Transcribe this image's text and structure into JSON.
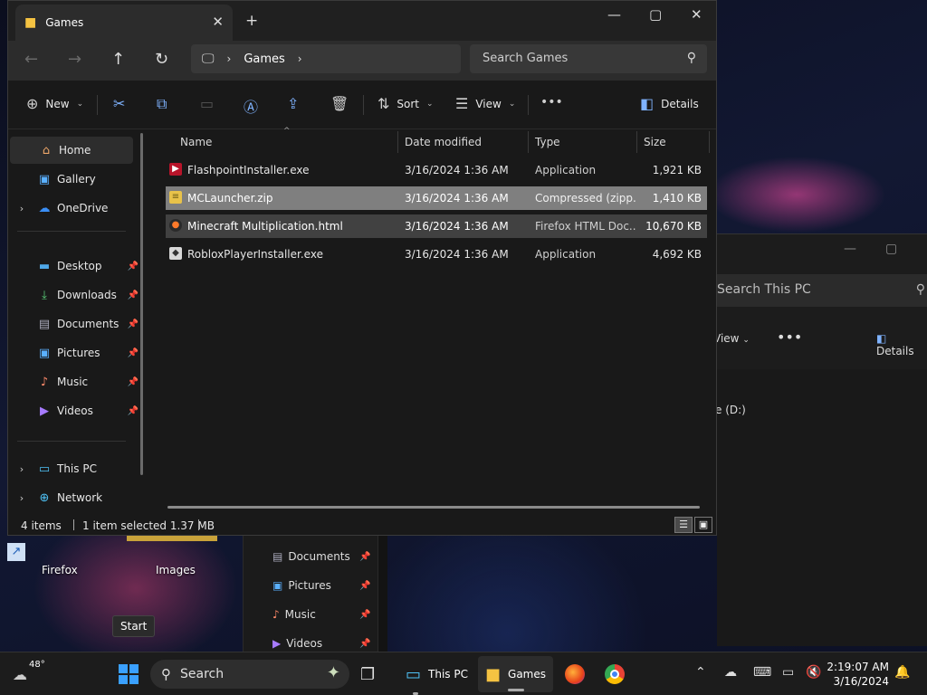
{
  "window": {
    "tab_title": "Games",
    "address_segment": "Games",
    "search_placeholder": "Search Games"
  },
  "toolbar": {
    "new_label": "New",
    "sort_label": "Sort",
    "view_label": "View",
    "details_label": "Details"
  },
  "sidebar": {
    "home": "Home",
    "gallery": "Gallery",
    "onedrive": "OneDrive",
    "desktop": "Desktop",
    "downloads": "Downloads",
    "documents": "Documents",
    "pictures": "Pictures",
    "music": "Music",
    "videos": "Videos",
    "thispc": "This PC",
    "network": "Network"
  },
  "columns": {
    "name": "Name",
    "date": "Date modified",
    "type": "Type",
    "size": "Size"
  },
  "files": [
    {
      "name": "FlashpointInstaller.exe",
      "date": "3/16/2024 1:36 AM",
      "type": "Application",
      "size": "1,921 KB"
    },
    {
      "name": "MCLauncher.zip",
      "date": "3/16/2024 1:36 AM",
      "type": "Compressed (zipp...",
      "size": "1,410 KB"
    },
    {
      "name": "Minecraft Multiplication.html",
      "date": "3/16/2024 1:36 AM",
      "type": "Firefox HTML Doc...",
      "size": "10,670 KB"
    },
    {
      "name": "RobloxPlayerInstaller.exe",
      "date": "3/16/2024 1:36 AM",
      "type": "Application",
      "size": "4,692 KB"
    }
  ],
  "status": {
    "items": "4 items",
    "selected": "1 item selected  1.37 MB"
  },
  "back_window": {
    "search_placeholder": "Search This PC",
    "view_label": "View",
    "details_label": "Details",
    "drive_label": "e (D:)"
  },
  "back_sidebar": {
    "documents": "Documents",
    "pictures": "Pictures",
    "music": "Music",
    "videos": "Videos"
  },
  "desktop": {
    "firefox_label": "Firefox",
    "images_label": "Images"
  },
  "tooltip": "Start",
  "taskbar": {
    "weather_temp": "48°",
    "search_label": "Search",
    "thispc_label": "This PC",
    "games_label": "Games",
    "time": "2:19:07 AM",
    "date": "3/16/2024"
  }
}
